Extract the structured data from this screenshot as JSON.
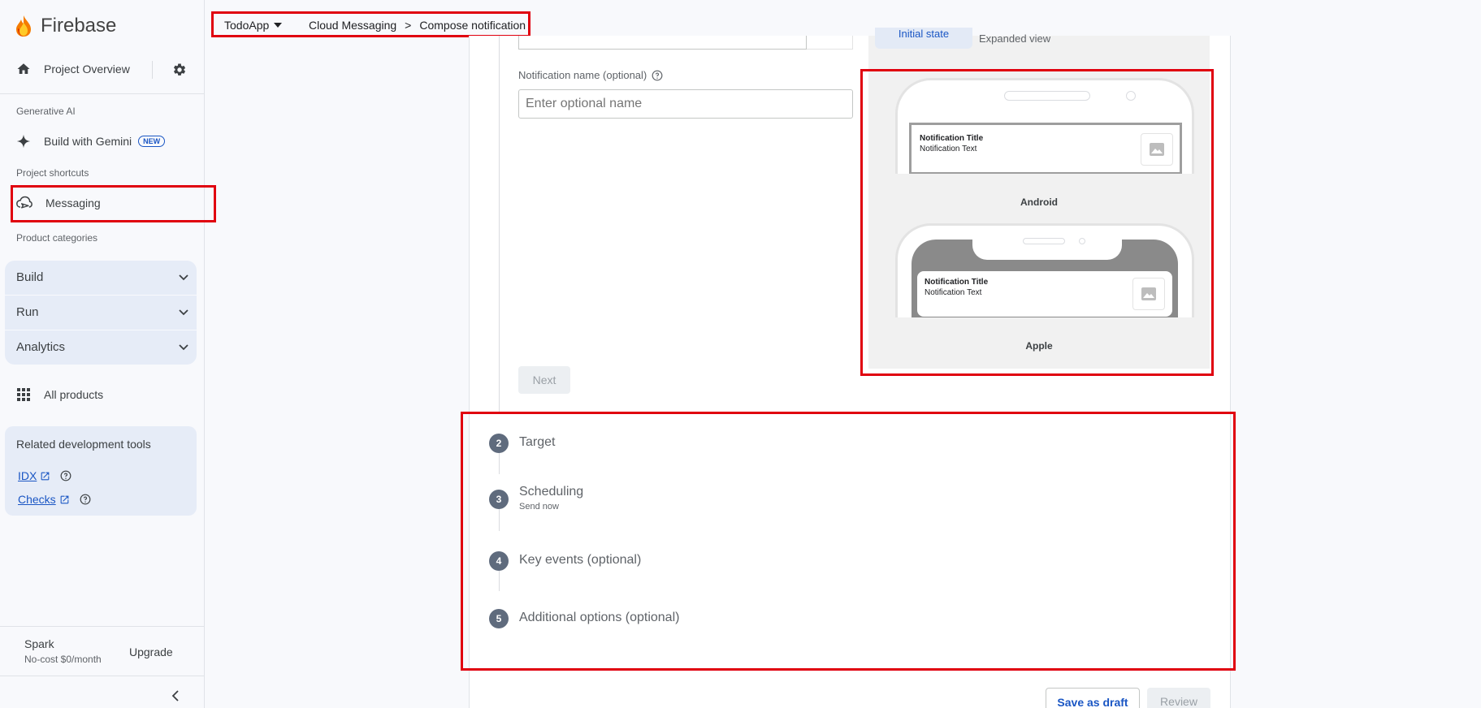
{
  "sidebar": {
    "brand": "Firebase",
    "project_overview": "Project Overview",
    "section_generative_ai": "Generative AI",
    "build_with_gemini": "Build with Gemini",
    "new_badge": "NEW",
    "section_shortcuts": "Project shortcuts",
    "messaging": "Messaging",
    "section_categories": "Product categories",
    "categories": [
      "Build",
      "Run",
      "Analytics"
    ],
    "all_products": "All products",
    "tools_title": "Related development tools",
    "tools": [
      "IDX",
      "Checks"
    ],
    "plan_name": "Spark",
    "plan_desc": "No-cost $0/month",
    "upgrade": "Upgrade"
  },
  "header": {
    "project": "TodoApp",
    "crumb_parent": "Cloud Messaging",
    "crumb_sep": ">",
    "crumb_current": "Compose notification"
  },
  "form": {
    "name_label": "Notification name (optional)",
    "name_placeholder": "Enter optional name",
    "next": "Next"
  },
  "preview": {
    "tabs": [
      "Initial state",
      "Expanded view"
    ],
    "android_label": "Android",
    "apple_label": "Apple",
    "notif_title": "Notification Title",
    "notif_text": "Notification Text"
  },
  "steps": [
    {
      "num": "2",
      "title": "Target",
      "sub": ""
    },
    {
      "num": "3",
      "title": "Scheduling",
      "sub": "Send now"
    },
    {
      "num": "4",
      "title": "Key events (optional)",
      "sub": ""
    },
    {
      "num": "5",
      "title": "Additional options (optional)",
      "sub": ""
    }
  ],
  "actions": {
    "save_draft": "Save as draft",
    "review": "Review"
  },
  "colors": {
    "accent": "#1a56c4",
    "highlight": "#e0000f",
    "step_circle": "#5f6b7d"
  }
}
